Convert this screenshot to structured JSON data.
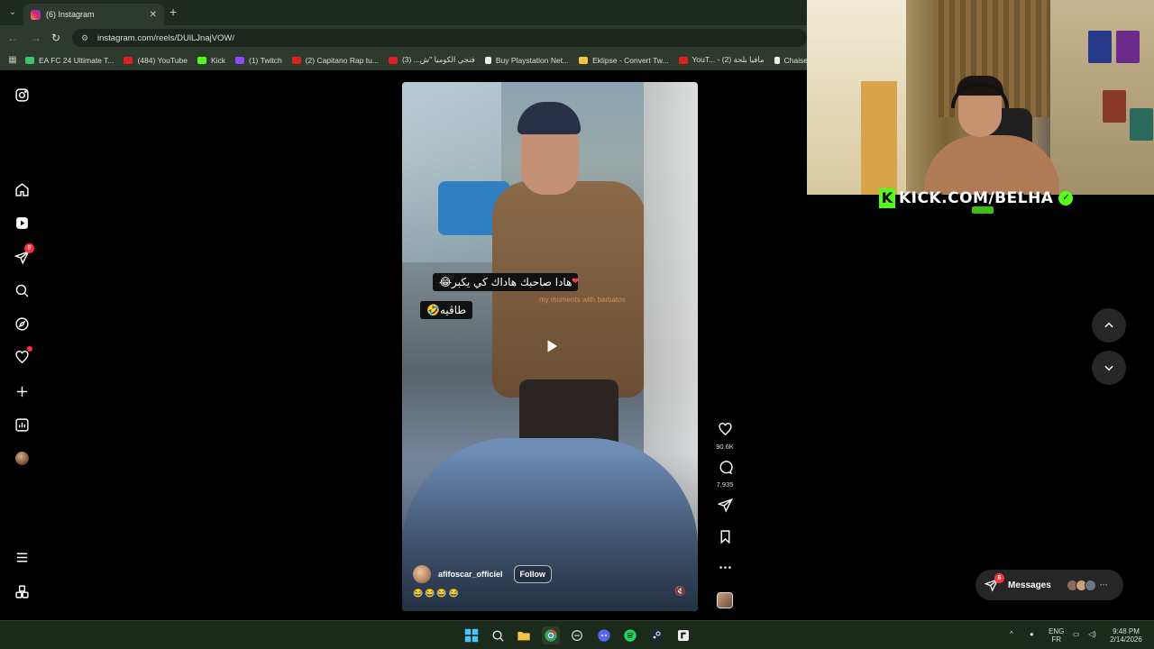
{
  "browser": {
    "tab": {
      "title": "(6) Instagram"
    },
    "url": "instagram.com/reels/DUlLJnajVOW/",
    "bookmarks": [
      {
        "label": "EA FC 24 Ultimate T...",
        "icon": "ea"
      },
      {
        "label": "(484) YouTube",
        "icon": "yt"
      },
      {
        "label": "Kick",
        "icon": "kick"
      },
      {
        "label": "(1) Twitch",
        "icon": "tw"
      },
      {
        "label": "(2) Capitano Rap tu...",
        "icon": "yt"
      },
      {
        "label": "فنجي الكوميا \"ش... (3)",
        "icon": "yt"
      },
      {
        "label": "Buy Playstation Net...",
        "icon": "ps"
      },
      {
        "label": "Eklipse - Convert Tw...",
        "icon": "ek"
      },
      {
        "label": "YouT... - مافيا بلحة (2)",
        "icon": "yt"
      },
      {
        "label": "Chaise de Bure",
        "icon": "doc"
      }
    ]
  },
  "sidebar": {
    "items": [
      {
        "name": "instagram-logo-icon"
      },
      {
        "name": "home-icon"
      },
      {
        "name": "reels-icon"
      },
      {
        "name": "direct-icon",
        "badge": "8"
      },
      {
        "name": "search-icon"
      },
      {
        "name": "explore-icon"
      },
      {
        "name": "notifications-icon",
        "dot": true
      },
      {
        "name": "create-icon"
      },
      {
        "name": "dashboard-icon"
      },
      {
        "name": "profile-avatar"
      },
      {
        "name": "more-menu-icon"
      },
      {
        "name": "also-from-meta-icon"
      }
    ]
  },
  "reel": {
    "caption_line1": "هادا صاحبك هاداك كي يكبر😂",
    "caption_line2": "طاڨيه🤣",
    "watermark": "my moments with barbatos",
    "creator": "afifoscar_officiel",
    "follow_label": "Follow",
    "emojis": "😂😂😂😂",
    "likes": "90.6K",
    "comments": "7,935"
  },
  "messages": {
    "label": "Messages",
    "badge": "6",
    "more": "···"
  },
  "webcam": {
    "brand": "KICK.COM/BELHA"
  },
  "taskbar": {
    "lang_top": "ENG",
    "lang_bottom": "FR",
    "time": "9:48 PM",
    "date": "2/14/2026"
  },
  "colors": {
    "accent_red": "#ff3040",
    "kick_green": "#53fc18",
    "browser_bg": "#2f3a2e"
  }
}
